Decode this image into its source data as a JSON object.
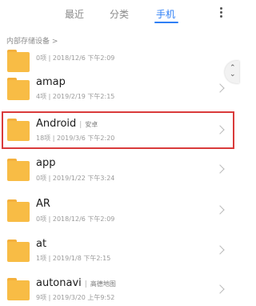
{
  "tabs": [
    {
      "label": "最近"
    },
    {
      "label": "分类"
    },
    {
      "label": "手机"
    }
  ],
  "active_tab": "手机",
  "breadcrumb": "内部存储设备 >",
  "folders": [
    {
      "name": "",
      "meta": "0项 | 2018/12/6 下午2:09"
    },
    {
      "name": "amap",
      "meta": "4项 | 2019/2/19 下午2:15"
    },
    {
      "name": "Android",
      "tag": "安卓",
      "meta": "18项 | 2019/3/6 下午2:20"
    },
    {
      "name": "app",
      "meta": "0项 | 2019/1/22 下午3:24"
    },
    {
      "name": "AR",
      "meta": "0项 | 2018/12/6 下午2:09"
    },
    {
      "name": "at",
      "meta": "1项 | 2019/1/8 下午2:15"
    },
    {
      "name": "autonavi",
      "tag": "高德地图",
      "meta": "9项 | 2019/3/20 上午9:52"
    }
  ],
  "icons": {
    "folder": "folder-icon",
    "chevron": "chevron-right-icon",
    "more": "more-vertical-icon",
    "scroll": "scroll-handle-icon"
  },
  "colors": {
    "accent": "#2f7ff5",
    "folder": "#f8bc45",
    "highlight": "#d93b3b"
  }
}
